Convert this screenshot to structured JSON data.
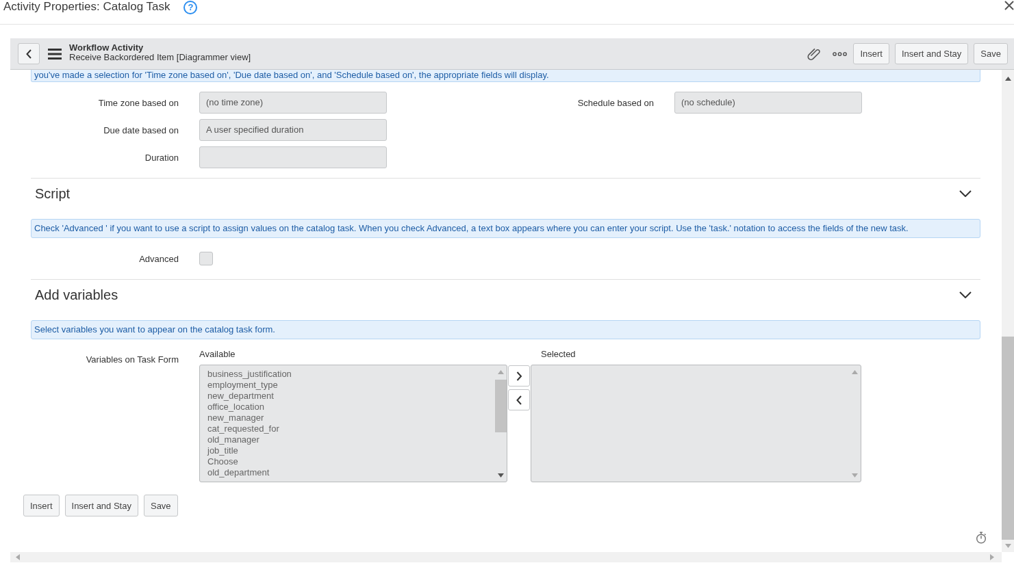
{
  "dialog": {
    "title": "Activity Properties: Catalog Task",
    "help": "?"
  },
  "header": {
    "title": "Workflow Activity",
    "subtitle": "Receive Backordered Item [Diagrammer view]",
    "buttons": [
      "Insert",
      "Insert and Stay",
      "Save"
    ]
  },
  "notice": "you've made a selection for 'Time zone based on', 'Due date based on', and 'Schedule based on', the appropriate fields will display.",
  "rows": [
    {
      "fields": [
        {
          "label": "Time zone based on",
          "value": "(no time zone)",
          "disabled": true
        },
        {
          "label": "Schedule based on",
          "value": "(no schedule)",
          "disabled": true
        }
      ]
    },
    {
      "fields": [
        {
          "label": "Due date based on",
          "value": "A user specified duration",
          "disabled": true
        }
      ]
    },
    {
      "fields": [
        {
          "label": "Duration",
          "disabled": true
        }
      ]
    }
  ],
  "sections": [
    {
      "title": "Script",
      "expanded": true,
      "info": "Check 'Advanced ' if you want to use a script to assign values on the catalog task. When you check Advanced, a text box appears where you can enter your script. Use the 'task.' notation to access the fields of the new task.",
      "kind": "checkbox",
      "field": {
        "label": "Advanced",
        "checked": false
      }
    },
    {
      "title": "Add variables",
      "expanded": true,
      "info": "Select variables you want to appear on the catalog task form.",
      "kind": "slushbucket",
      "field": {
        "label": "Variables on Task Form",
        "available_title": "Available",
        "available": [
          "business_justification",
          "employment_type",
          "new_department",
          "office_location",
          "new_manager",
          "cat_requested_for",
          "old_manager",
          "job_title",
          "Choose",
          "old_department"
        ],
        "selected_title": "Selected"
      }
    }
  ],
  "buttons": [
    "Insert",
    "Insert and Stay",
    "Save"
  ]
}
